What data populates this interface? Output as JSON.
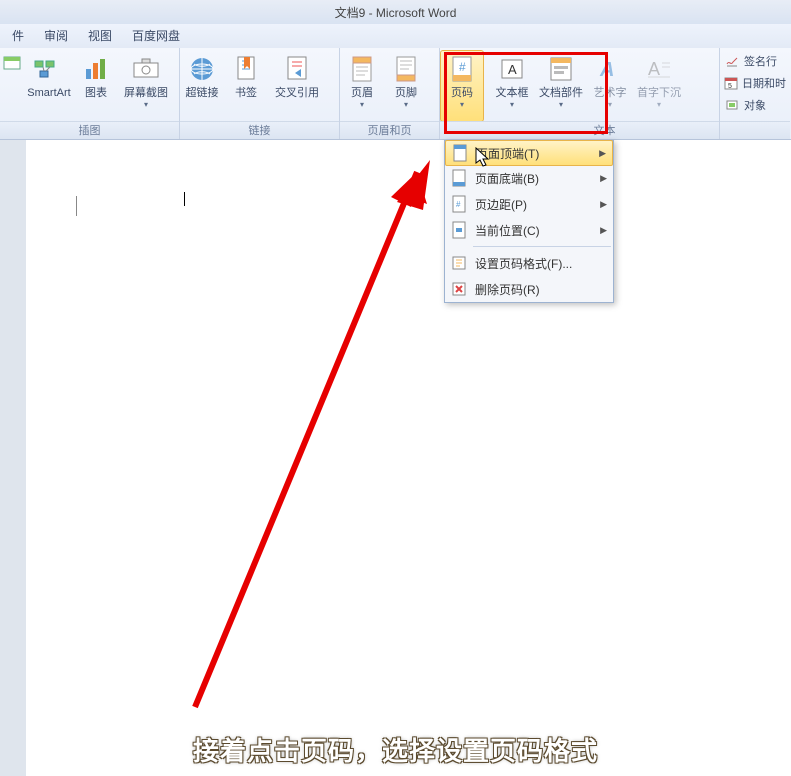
{
  "title": "文档9 - Microsoft Word",
  "tabs": {
    "t0": "件",
    "t1": "审阅",
    "t2": "视图",
    "t3": "百度网盘"
  },
  "ribbon": {
    "smartart": "SmartArt",
    "chart": "图表",
    "screenshot": "屏幕截图",
    "hyperlink": "超链接",
    "bookmark": "书签",
    "crossref": "交叉引用",
    "header": "页眉",
    "footer": "页脚",
    "pagenum": "页码",
    "textbox": "文本框",
    "quickparts": "文档部件",
    "wordart": "艺术字",
    "dropcap": "首字下沉",
    "grp_illustrations": "插图",
    "grp_links": "链接",
    "grp_headerfooter": "页眉和页",
    "grp_text": "文本",
    "signature": "签名行",
    "datetime": "日期和时",
    "object": "对象"
  },
  "dropdown": {
    "top": "页面顶端(T)",
    "bottom": "页面底端(B)",
    "margins": "页边距(P)",
    "current": "当前位置(C)",
    "format": "设置页码格式(F)...",
    "remove": "删除页码(R)"
  },
  "caption": "接着点击页码，选择设置页码格式"
}
